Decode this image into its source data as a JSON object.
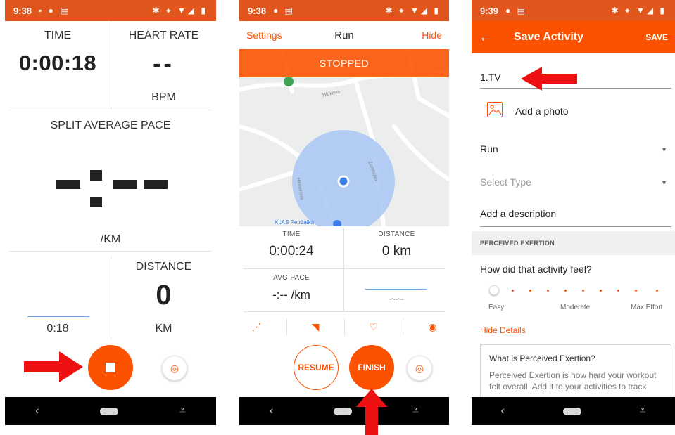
{
  "screen1": {
    "status_time": "9:38",
    "time_label": "TIME",
    "time_value": "0:00:18",
    "hr_label": "HEART RATE",
    "hr_value": "--",
    "hr_unit": "BPM",
    "pace_label": "SPLIT AVERAGE PACE",
    "pace_unit": "/KM",
    "split_time": "0:18",
    "distance_label": "DISTANCE",
    "distance_value": "0",
    "distance_unit": "KM"
  },
  "screen2": {
    "status_time": "9:38",
    "settings_label": "Settings",
    "title": "Run",
    "hide_label": "Hide",
    "stopped_label": "STOPPED",
    "map_labels": [
      "Hlúkova",
      "Heinerova",
      "Zombova",
      "KLAS Petržalka"
    ],
    "time_label": "TIME",
    "time_value": "0:00:24",
    "distance_label": "DISTANCE",
    "distance_value": "0 km",
    "avg_pace_label": "AVG PACE",
    "avg_pace_value": "-:-- /km",
    "split_pace": "-:--:--",
    "resume_label": "RESUME",
    "finish_label": "FINISH"
  },
  "screen3": {
    "status_time": "9:39",
    "title": "Save Activity",
    "save_label": "SAVE",
    "activity_name": "1.TV",
    "add_photo_label": "Add a photo",
    "sport_value": "Run",
    "type_placeholder": "Select Type",
    "description_placeholder": "Add a description",
    "section_label": "PERCEIVED EXERTION",
    "question": "How did that activity feel?",
    "scale_easy": "Easy",
    "scale_moderate": "Moderate",
    "scale_max": "Max Effort",
    "hide_details": "Hide Details",
    "info_title": "What is Perceived Exertion?",
    "info_text": "Perceived Exertion is how hard your workout felt overall. Add it to your activities to track"
  },
  "colors": {
    "brand_orange": "#fc5200",
    "status_bar": "#e0561c",
    "arrow_red": "#ee1111",
    "map_bg": "#eceded",
    "accuracy_circle": "#a8c5f5",
    "location_dot": "#3c7ee6"
  },
  "icons": [
    "stop-icon",
    "location-pin-icon",
    "route-icon",
    "shoe-icon",
    "heart-icon",
    "sensor-icon",
    "photo-icon",
    "back-arrow-icon",
    "dropdown-caret-icon"
  ]
}
